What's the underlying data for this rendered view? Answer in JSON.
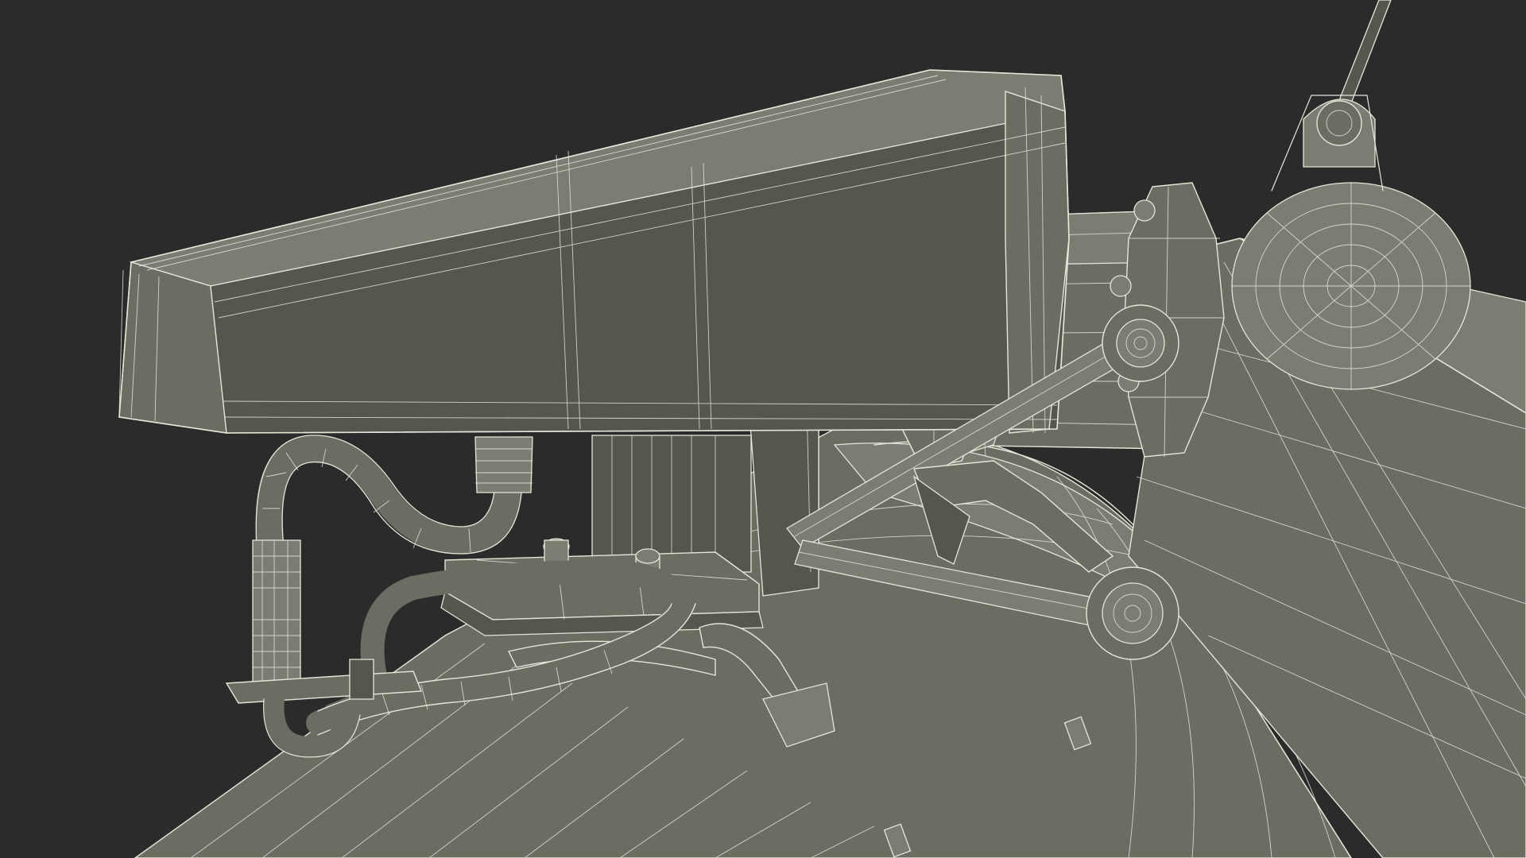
{
  "scene": {
    "background": "#2b2b2b",
    "wire_color": "#e6e6d8",
    "surface_colors": [
      "#55564e",
      "#6b6c62",
      "#7c7d72"
    ]
  }
}
